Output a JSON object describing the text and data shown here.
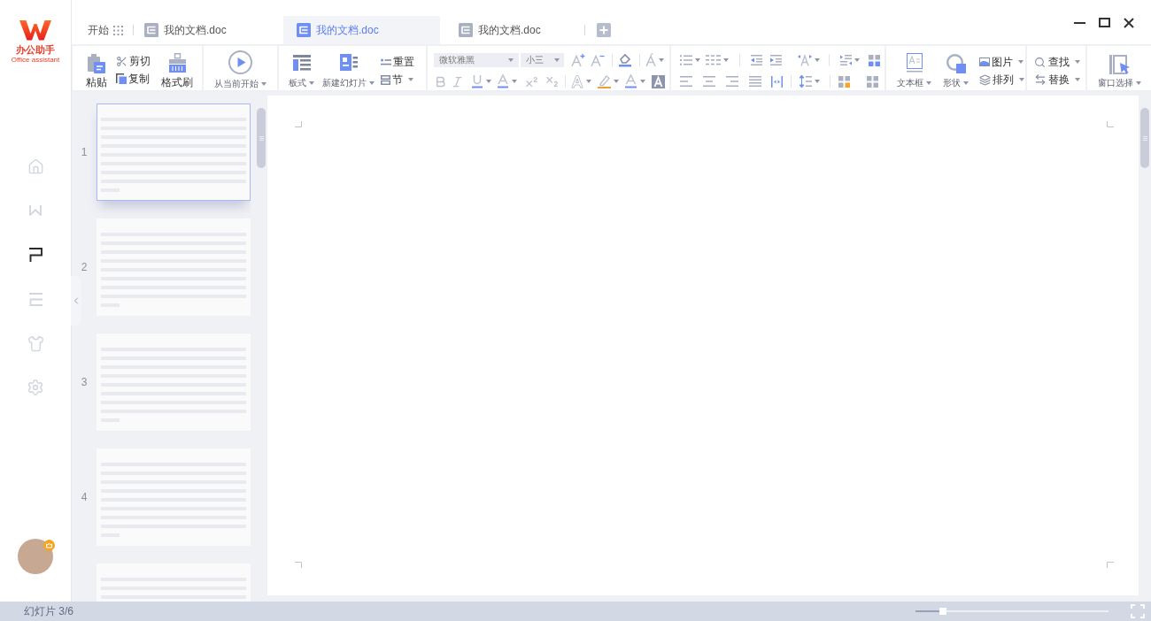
{
  "logo": {
    "title": "办公助手",
    "subtitle": "Office assistant"
  },
  "sidebar": {
    "items": [
      {
        "kind": "home",
        "selected": false
      },
      {
        "kind": "writer",
        "selected": false
      },
      {
        "kind": "presentation",
        "selected": true
      },
      {
        "kind": "spreadsheet",
        "selected": false
      },
      {
        "kind": "skins",
        "selected": false
      },
      {
        "kind": "settings",
        "selected": false
      }
    ]
  },
  "tabs": {
    "start": {
      "label": "开始"
    },
    "documents": [
      {
        "label": "我的文档.doc",
        "selected": false
      },
      {
        "label": "我的文档.doc",
        "selected": true
      },
      {
        "label": "我的文档.doc",
        "selected": false
      }
    ]
  },
  "ribbon": {
    "clipboard": {
      "paste": "粘贴",
      "cut": "剪切",
      "copy": "复制",
      "format_painter": "格式刷"
    },
    "slideshow": {
      "from_current": "从当前开始"
    },
    "slides": {
      "layout": "板式",
      "new_slide": "新建幻灯片",
      "reset": "重置",
      "section": "节"
    },
    "font": {
      "name": "微软雅黑",
      "size": "小三"
    },
    "insert": {
      "text_box": "文本框",
      "shape": "形状",
      "picture": "图片",
      "arrange": "排列"
    },
    "editing": {
      "find": "查找",
      "replace": "替换"
    },
    "window": {
      "select": "窗口选择"
    }
  },
  "slides": [
    {
      "number": "1",
      "selected": true
    },
    {
      "number": "2",
      "selected": false
    },
    {
      "number": "3",
      "selected": false
    },
    {
      "number": "4",
      "selected": false
    },
    {
      "selected": false
    }
  ],
  "status_bar": {
    "slide_counter": "幻灯片 3/6",
    "zoom": {
      "level": 0.14
    }
  }
}
